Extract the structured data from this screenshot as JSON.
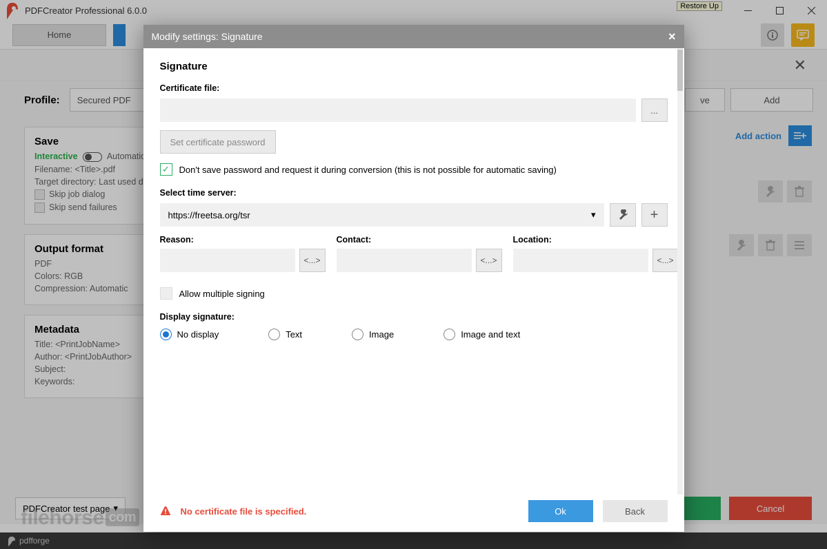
{
  "window": {
    "title": "PDFCreator Professional 6.0.0",
    "restore_tip": "Restore Up"
  },
  "nav": {
    "home": "Home"
  },
  "profile": {
    "label": "Profile:",
    "selected": "Secured PDF",
    "remove": "ve",
    "add": "Add"
  },
  "add_action": "Add action",
  "panels": {
    "save": {
      "title": "Save",
      "interactive": "Interactive",
      "automatic": "Automatic",
      "filename_lbl": "Filename:",
      "filename_val": "<Title>.pdf",
      "target_lbl": "Target directory:",
      "target_val": "Last used d",
      "skip_job": "Skip job dialog",
      "skip_send": "Skip send failures"
    },
    "output": {
      "title": "Output format",
      "format": "PDF",
      "colors_lbl": "Colors:",
      "colors_val": "RGB",
      "comp_lbl": "Compression:",
      "comp_val": "Automatic"
    },
    "metadata": {
      "title": "Metadata",
      "title_lbl": "Title:",
      "title_val": "<PrintJobName>",
      "author_lbl": "Author:",
      "author_val": "<PrintJobAuthor>",
      "subject_lbl": "Subject:",
      "keywords_lbl": "Keywords:"
    }
  },
  "bottom": {
    "test_page": "PDFCreator test page",
    "cancel": "Cancel"
  },
  "footer_brand": "pdfforge",
  "watermark": {
    "a": "filehorse",
    "b": "com"
  },
  "modal": {
    "header": "Modify settings: Signature",
    "title": "Signature",
    "cert_label": "Certificate file:",
    "browse": "...",
    "set_pw": "Set certificate password",
    "dont_save": "Don't save password and request it during conversion (this is not possible for automatic saving)",
    "ts_label": "Select time server:",
    "ts_value": "https://freetsa.org/tsr",
    "reason": "Reason:",
    "contact": "Contact:",
    "location": "Location:",
    "token": "<...>",
    "allow_multi": "Allow multiple signing",
    "display_label": "Display signature:",
    "radios": [
      "No display",
      "Text",
      "Image",
      "Image and text"
    ],
    "error": "No certificate file is specified.",
    "ok": "Ok",
    "back": "Back"
  }
}
